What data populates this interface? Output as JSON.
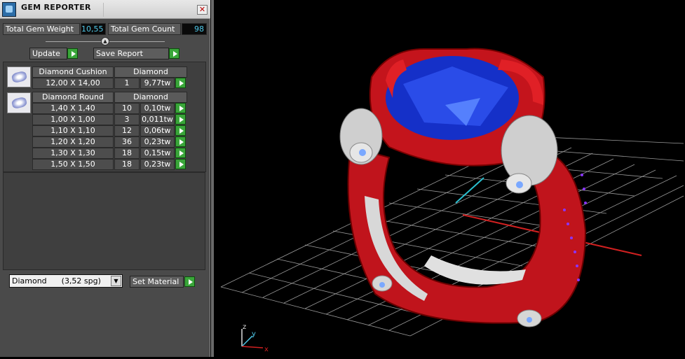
{
  "window": {
    "title": "GEM REPORTER"
  },
  "stats": {
    "weight_label": "Total Gem Weight",
    "weight_value": "10,55",
    "count_label": "Total Gem Count",
    "count_value": "98"
  },
  "buttons": {
    "update": "Update",
    "save_report": "Save Report",
    "set_material": "Set Material"
  },
  "groups": [
    {
      "name": "Diamond Cushion",
      "material": "Diamond",
      "rows": [
        {
          "size": "12,00 X 14,00",
          "count": "1",
          "weight": "9,77tw"
        }
      ]
    },
    {
      "name": "Diamond Round",
      "material": "Diamond",
      "rows": [
        {
          "size": "1,40 X 1,40",
          "count": "10",
          "weight": "0,10tw"
        },
        {
          "size": "1,00 X 1,00",
          "count": "3",
          "weight": "0,011tw"
        },
        {
          "size": "1,10 X 1,10",
          "count": "12",
          "weight": "0,06tw"
        },
        {
          "size": "1,20 X 1,20",
          "count": "36",
          "weight": "0,23tw"
        },
        {
          "size": "1,30 X 1,30",
          "count": "18",
          "weight": "0,15tw"
        },
        {
          "size": "1,50 X 1,50",
          "count": "18",
          "weight": "0,23tw"
        }
      ]
    }
  ],
  "material_select": {
    "value": "Diamond      (3,52 spg)"
  },
  "axes": {
    "z": "z",
    "y": "y",
    "x": "x"
  },
  "colors": {
    "accent_green": "#3aa63a",
    "value_cyan": "#4fc8e8",
    "ring_red": "#c0141c",
    "gem_blue": "#1530c8"
  }
}
